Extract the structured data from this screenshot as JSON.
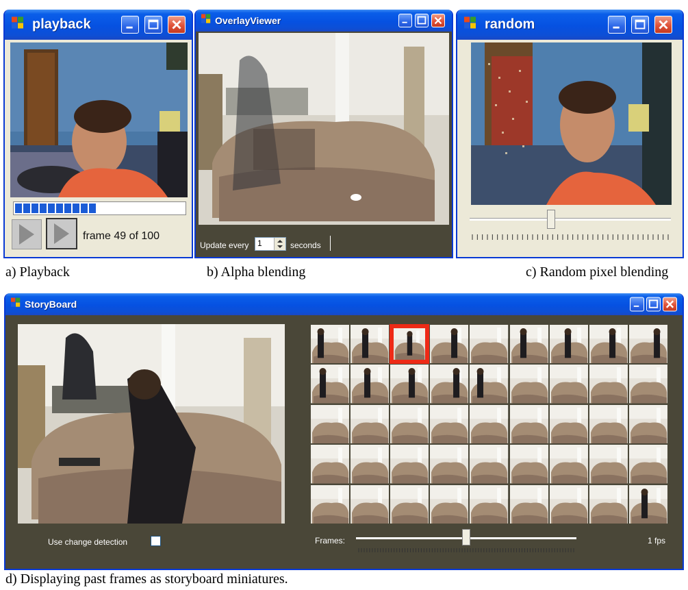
{
  "playback": {
    "title": "playback",
    "frame_text": "frame 49 of 100",
    "progress": 0.49
  },
  "overlay": {
    "title": "OverlayViewer",
    "update_label": "Update every",
    "update_value": "1",
    "seconds_label": "seconds"
  },
  "random": {
    "title": "random",
    "slider_value": 0.4
  },
  "storyboard": {
    "title": "StoryBoard",
    "change_detection_label": "Use change detection",
    "frames_label": "Frames:",
    "fps_label": "1 fps",
    "frames_slider_value": 0.5,
    "thumbnail_columns": 9,
    "thumbnail_rows": 5,
    "selected_thumbnail": 2
  },
  "captions": {
    "a": "a) Playback",
    "b": "b) Alpha blending",
    "c": "c) Random pixel blending",
    "d": "d) Displaying past frames as storyboard miniatures."
  }
}
